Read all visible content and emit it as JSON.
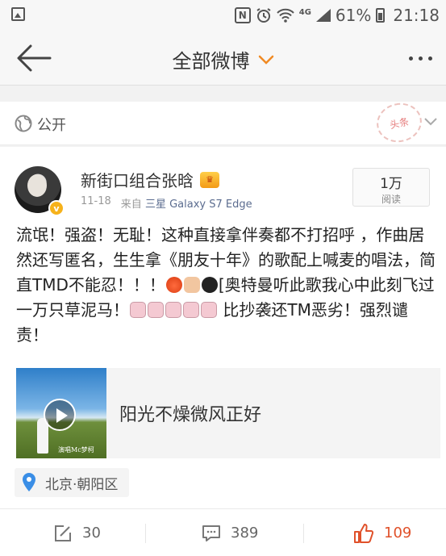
{
  "status_bar": {
    "network": "4G",
    "battery_percent": "61%",
    "time": "21:18",
    "icons": [
      "image-icon",
      "nfc-icon",
      "alarm-icon",
      "wifi-icon",
      "signal-icon",
      "battery-icon"
    ]
  },
  "nav": {
    "title": "全部微博",
    "back_icon": "arrow-left-icon",
    "dropdown_icon": "chevron-down-icon",
    "more_icon": "more-dots-icon"
  },
  "visibility": {
    "label": "公开",
    "icon": "globe-icon",
    "stamp_text": "头条"
  },
  "post": {
    "author": "新街口组合张晗",
    "date": "11-18",
    "source_prefix": "来自",
    "source": "三星 Galaxy S7 Edge",
    "reads_count": "1万",
    "reads_label": "阅读",
    "text_part1": "流氓！强盗！无耻！这种直接拿伴奏都不打招呼 ，作曲居然还写匿名，生生拿《朋友十年》的歌配上喊麦的唱法，简直TMD不能忍！！！",
    "text_part2": "[奥特曼听此歌我心中此刻飞过一万只草泥马！",
    "text_part3": " 比抄袭还TM恶劣！强烈谴责！",
    "music_card": {
      "title": "阳光不燥微风正好",
      "thumb_caption": "演唱Mc梦柯"
    },
    "location": "北京·朝阳区"
  },
  "actions": {
    "repost_count": "30",
    "comment_count": "389",
    "like_count": "109"
  },
  "colors": {
    "accent_orange": "#f08a24",
    "like_orange": "#e0512a",
    "vip_gold": "#f6b21b",
    "link_blue": "#5b6c8f"
  }
}
